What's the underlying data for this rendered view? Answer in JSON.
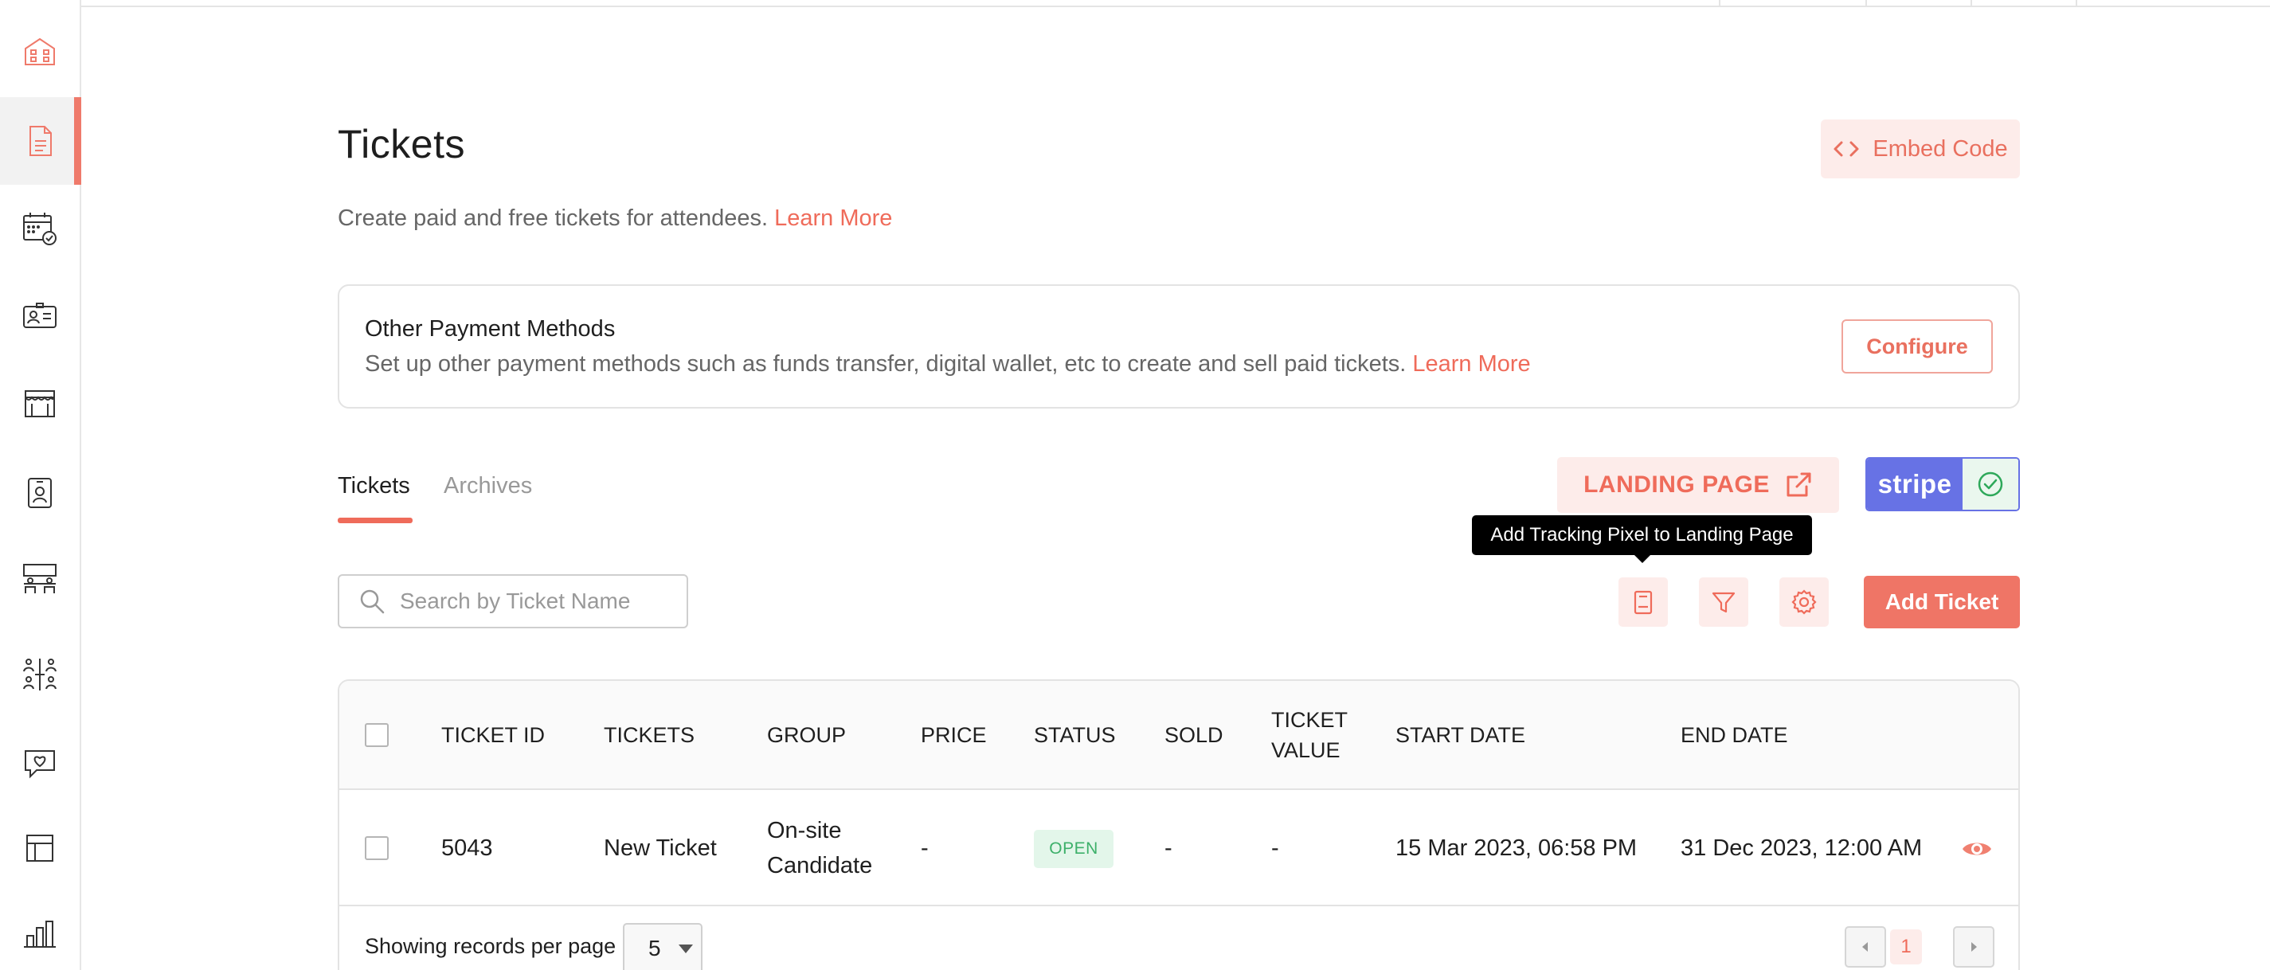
{
  "colors": {
    "accent": "#ef6b5a",
    "accent_light": "#fdecea",
    "stripe": "#6772e5",
    "status_open_bg": "#e3f6ea",
    "status_open_fg": "#3db06a"
  },
  "sidebar": {
    "items": [
      {
        "icon": "building-icon",
        "active": false
      },
      {
        "icon": "document-icon",
        "active": true
      },
      {
        "icon": "calendar-check-icon",
        "active": false
      },
      {
        "icon": "id-card-icon",
        "active": false
      },
      {
        "icon": "storefront-icon",
        "active": false
      },
      {
        "icon": "badge-icon",
        "active": false
      },
      {
        "icon": "meeting-table-icon",
        "active": false
      },
      {
        "icon": "people-network-icon",
        "active": false
      },
      {
        "icon": "heart-chat-icon",
        "active": false
      },
      {
        "icon": "layout-icon",
        "active": false
      },
      {
        "icon": "bar-chart-icon",
        "active": false
      }
    ]
  },
  "header": {
    "title": "Tickets",
    "embed_label": "Embed Code",
    "subtitle": "Create paid and free tickets for attendees.",
    "learn_more": "Learn More"
  },
  "payment_card": {
    "title": "Other Payment Methods",
    "description": "Set up other payment methods such as funds transfer, digital wallet, etc to create and sell paid tickets.",
    "learn_more": "Learn More",
    "configure_label": "Configure"
  },
  "tabs": [
    {
      "label": "Tickets",
      "active": true
    },
    {
      "label": "Archives",
      "active": false
    }
  ],
  "landing_page_label": "LANDING PAGE",
  "stripe": {
    "label": "stripe",
    "connected": true
  },
  "tooltip": "Add Tracking Pixel to Landing Page",
  "toolbar": {
    "search_placeholder": "Search by Ticket Name",
    "add_ticket_label": "Add Ticket"
  },
  "table": {
    "columns": [
      "TICKET ID",
      "TICKETS",
      "GROUP",
      "PRICE",
      "STATUS",
      "SOLD",
      "TICKET VALUE",
      "START DATE",
      "END DATE"
    ],
    "rows": [
      {
        "ticket_id": "5043",
        "ticket": "New Ticket",
        "group": "On-site Candidate",
        "price": "-",
        "status": "OPEN",
        "sold": "-",
        "ticket_value": "-",
        "start_date": "15 Mar 2023, 06:58 PM",
        "end_date": "31 Dec 2023, 12:00 AM"
      }
    ]
  },
  "pagination": {
    "per_page_label": "Showing records per page",
    "per_page": "5",
    "current_page": "1"
  }
}
